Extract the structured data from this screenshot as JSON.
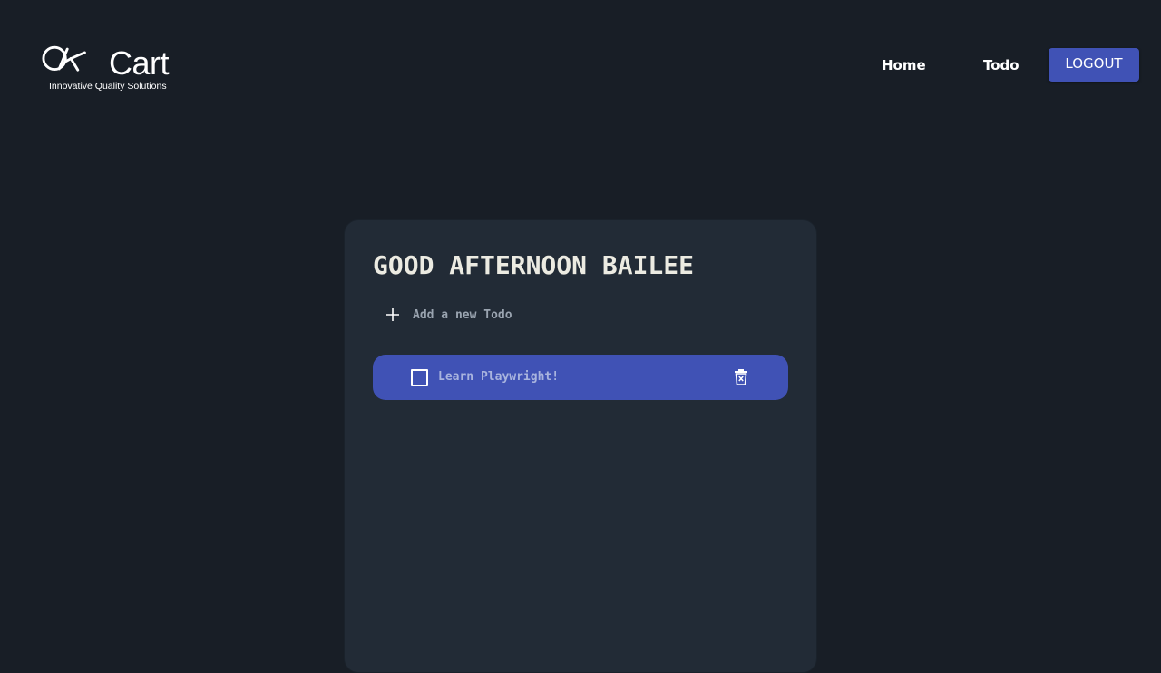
{
  "logo": {
    "brand": "Cart",
    "tagline": "Innovative Quality Solutions"
  },
  "nav": {
    "home": "Home",
    "todo": "Todo",
    "logout": "LOGOUT"
  },
  "todo_card": {
    "greeting": "GOOD AFTERNOON BAILEE",
    "add_placeholder": "Add a new Todo",
    "items": [
      {
        "text": "Learn Playwright!",
        "completed": false
      }
    ]
  },
  "icons": {
    "add": "plus-icon",
    "delete": "trash-icon",
    "checkbox": "checkbox-icon"
  },
  "colors": {
    "background": "#181e26",
    "card": "#222b36",
    "accent": "#4052b5",
    "greeting_text": "#ecebe2"
  }
}
